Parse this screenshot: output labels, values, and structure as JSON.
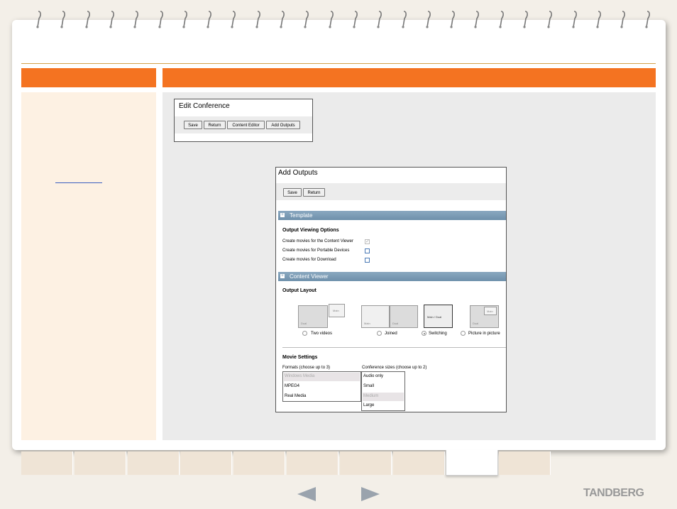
{
  "edit_conference": {
    "title": "Edit Conference",
    "buttons": [
      "Save",
      "Return",
      "Content Editor",
      "Add Outputs"
    ]
  },
  "add_outputs": {
    "title": "Add Outputs",
    "buttons": [
      "Save",
      "Return"
    ],
    "template_section": "Template",
    "output_viewing_options": {
      "title": "Output Viewing Options",
      "options": [
        {
          "label": "Create movies for the Content Viewer",
          "checked": true
        },
        {
          "label": "Create movies for Portable Devices",
          "checked": false
        },
        {
          "label": "Create movies for Download",
          "checked": false
        }
      ]
    },
    "content_viewer_section": "Content Viewer",
    "output_layout": {
      "title": "Output Layout",
      "layouts": [
        {
          "label": "Two videos",
          "selected": false,
          "thumb_labels": [
            "Dual",
            "Main"
          ]
        },
        {
          "label": "Joined",
          "selected": false,
          "thumb_labels": [
            "Main",
            "Dual"
          ]
        },
        {
          "label": "Switching",
          "selected": true,
          "thumb_labels": [
            "Main / Dual"
          ]
        },
        {
          "label": "Picture in picture",
          "selected": false,
          "thumb_labels": [
            "Dual",
            "Main"
          ]
        }
      ]
    },
    "movie_settings": {
      "title": "Movie Settings",
      "formats_label": "Formats (choose up to 3)",
      "formats": [
        "Windows Media",
        "MPEG4",
        "Real Media"
      ],
      "formats_selected": "Windows Media",
      "sizes_label": "Conference sizes (choose up to 2)",
      "sizes": [
        "Audio only",
        "Small",
        "Medium",
        "Large"
      ],
      "sizes_selected": "Medium"
    }
  },
  "brand": "TANDBERG",
  "navigation": {
    "active_tab_index": 8,
    "tab_count": 10,
    "prev_icon": "left-arrow-icon",
    "next_icon": "right-arrow-icon"
  },
  "colors": {
    "accent": "#f47321",
    "section_header": "#7a9ab3",
    "side_panel": "#fdf1e3",
    "main_panel": "#ebebeb"
  }
}
